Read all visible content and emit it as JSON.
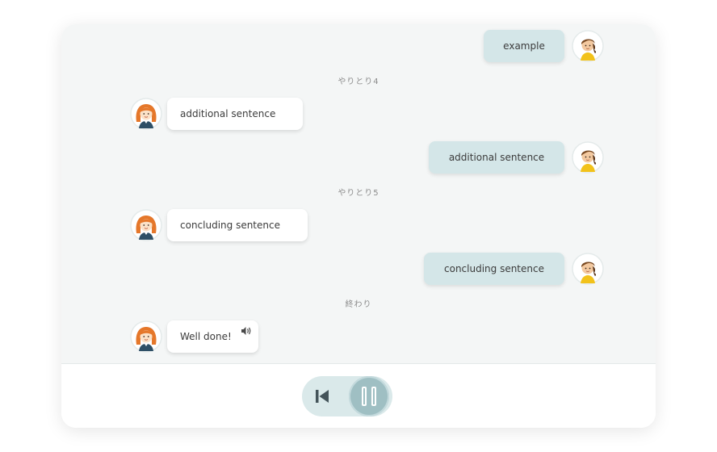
{
  "conversation": {
    "messages": [
      {
        "role": "user",
        "text": "example"
      },
      {
        "role": "divider",
        "text": "やりとり4"
      },
      {
        "role": "partner",
        "text": "additional sentence"
      },
      {
        "role": "user",
        "text": "additional sentence"
      },
      {
        "role": "divider",
        "text": "やりとり5"
      },
      {
        "role": "partner",
        "text": "concluding sentence"
      },
      {
        "role": "user",
        "text": "concluding sentence"
      },
      {
        "role": "divider",
        "text": "終わり"
      },
      {
        "role": "partner",
        "text": "Well done!"
      }
    ]
  },
  "controls": {
    "rewind_icon": "skip-back-icon",
    "pause_icon": "pause-icon"
  },
  "icons": {
    "partner_avatar": "girl-avatar-icon",
    "user_avatar": "boy-avatar-icon",
    "audio": "speaker-icon"
  },
  "colors": {
    "chat_background": "#f4f6f6",
    "user_bubble": "#d4e6e8",
    "partner_bubble": "#ffffff",
    "control_pill": "#dae9ea",
    "pause_button": "#9fbfc3"
  }
}
